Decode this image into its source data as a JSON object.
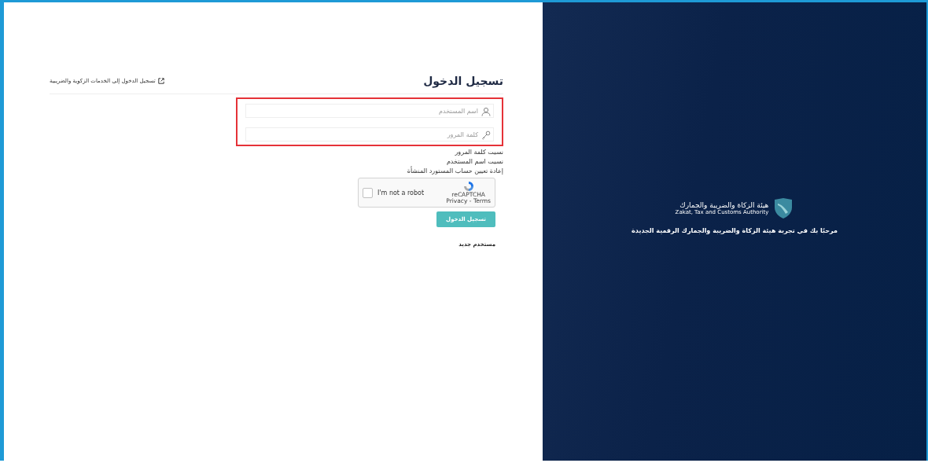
{
  "login": {
    "title": "تسجيل الدخول",
    "external_link": "تسجيل الدخول إلى الخدمات الزكوية والضريبية",
    "fields": [
      {
        "kind": "user",
        "placeholder": "اسم المستخدم"
      },
      {
        "kind": "key",
        "placeholder": "كلمة المرور"
      }
    ],
    "links": [
      "نسيت كلمة المرور",
      "نسيت اسم المستخدم",
      "إعادة تعيين حساب المستورد المنشأة"
    ],
    "captcha": {
      "label": "I'm not a robot",
      "checked": false,
      "brand": "reCAPTCHA",
      "terms": "Privacy - Terms"
    },
    "submit": "تسجيل الدخول",
    "new_user": "مستخدم جديد"
  },
  "brand": {
    "name_ar": "هيئة الزكاة والضريبة والجمارك",
    "name_en": "Zakat, Tax and Customs Authority",
    "welcome": "مرحبًا بك في تجربة هيئة الزكاة والضريبة والجمارك الرقمية الجديدة"
  }
}
